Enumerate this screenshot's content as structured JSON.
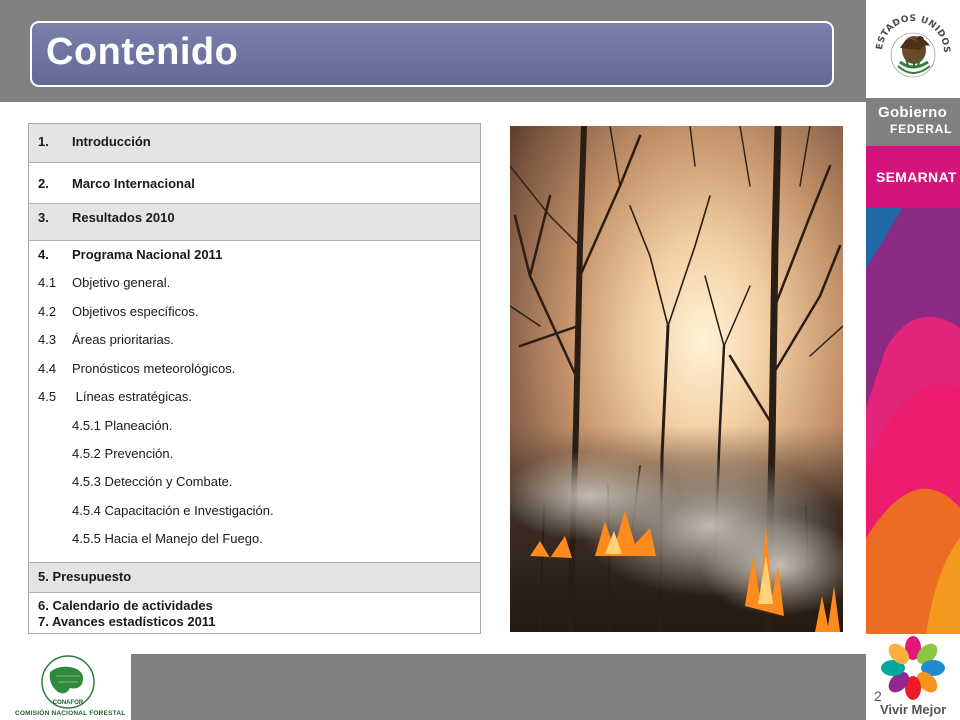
{
  "header": {
    "title": "Contenido"
  },
  "branding": {
    "seal_text": "ESTADOS UNIDOS MEXICANOS",
    "gobierno_line1": "Gobierno",
    "gobierno_line2": "FEDERAL",
    "semarnat": "SEMARNAT",
    "vivir_mejor": "Vivir Mejor",
    "conafor_short": "CONAFOR",
    "conafor_full": "COMISIÓN NACIONAL FORESTAL"
  },
  "toc": {
    "items": [
      {
        "num": "1.",
        "text": "Introducción"
      },
      {
        "num": "2.",
        "text": "Marco Internacional"
      },
      {
        "num": "3.",
        "text": "Resultados 2010"
      },
      {
        "num": "4.",
        "text": "Programa Nacional 2011"
      },
      {
        "num": "4.1",
        "text": "Objetivo general."
      },
      {
        "num": "4.2",
        "text": "Objetivos específicos."
      },
      {
        "num": "4.3",
        "text": "Áreas prioritarias."
      },
      {
        "num": "4.4",
        "text": "Pronósticos  meteorológicos."
      },
      {
        "num": "4.5",
        "text": " Líneas estratégicas."
      },
      {
        "num": "",
        "text": "4.5.1 Planeación."
      },
      {
        "num": "",
        "text": "4.5.2 Prevención."
      },
      {
        "num": "",
        "text": "4.5.3 Detección y Combate."
      },
      {
        "num": "",
        "text": "4.5.4 Capacitación e Investigación."
      },
      {
        "num": "",
        "text": "4.5.5 Hacia el Manejo del Fuego."
      },
      {
        "num": "",
        "text": "5. Presupuesto"
      },
      {
        "num": "",
        "text": "6. Calendario de actividades"
      },
      {
        "num": "",
        "text": "7. Avances estadísticos 2011"
      }
    ]
  },
  "footer": {
    "page_number": "2"
  },
  "colors": {
    "header_gray": "#808080",
    "title_box": "#6a7099",
    "semarnat_magenta": "#d4147c",
    "row_gray": "#e4e4e4"
  }
}
